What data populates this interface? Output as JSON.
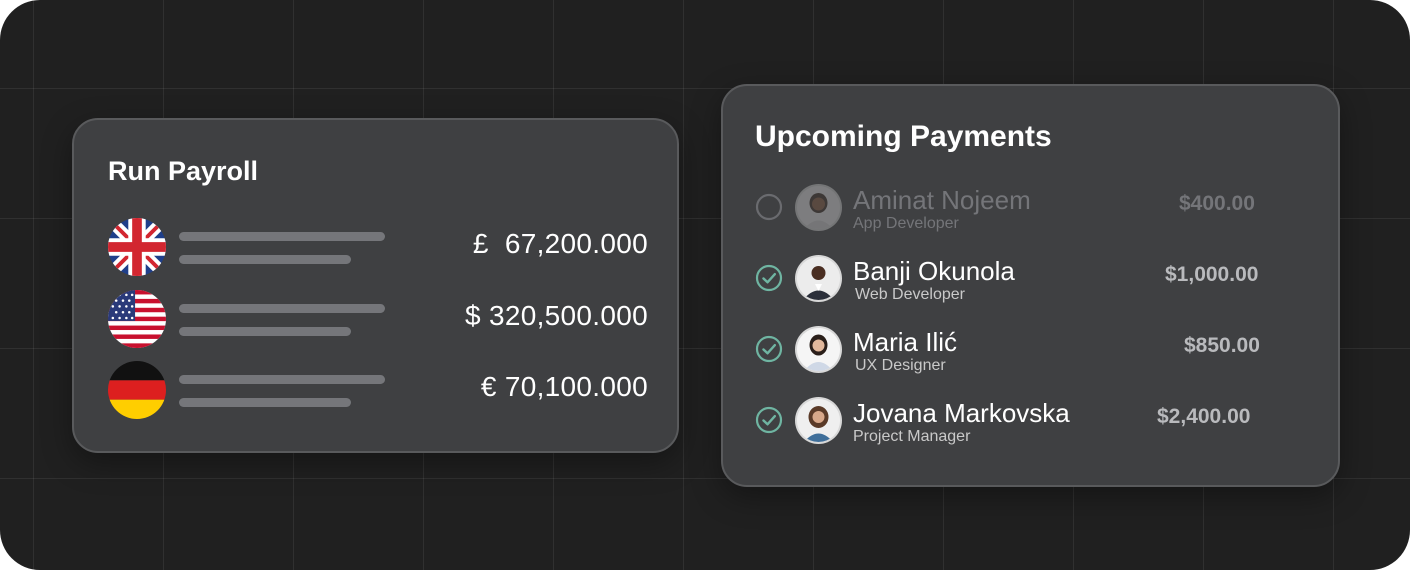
{
  "run_payroll": {
    "title": "Run Payroll",
    "rows": [
      {
        "flag_icon": "uk-flag-icon",
        "amount": "£  67,200.000"
      },
      {
        "flag_icon": "us-flag-icon",
        "amount": "$ 320,500.000"
      },
      {
        "flag_icon": "germany-flag-icon",
        "amount": "€ 70,100.000"
      }
    ]
  },
  "upcoming_payments": {
    "title": "Upcoming Payments",
    "people": [
      {
        "name": "Aminat Nojeem",
        "role": "App Developer",
        "amount": "$400.00",
        "status_icon": "empty-circle-icon",
        "selected": false
      },
      {
        "name": "Banji Okunola",
        "role": "Web Developer",
        "amount": "$1,000.00",
        "status_icon": "check-circle-icon",
        "selected": true
      },
      {
        "name": "Maria Ilić",
        "role": "UX Designer",
        "amount": "$850.00",
        "status_icon": "check-circle-icon",
        "selected": true
      },
      {
        "name": "Jovana Markovska",
        "role": "Project Manager",
        "amount": "$2,400.00",
        "status_icon": "check-circle-icon",
        "selected": true
      }
    ]
  },
  "colors": {
    "background": "#202020",
    "card": "#3f4042",
    "check_accent": "#6fb5a2",
    "placeholder_line": "#75767a"
  }
}
